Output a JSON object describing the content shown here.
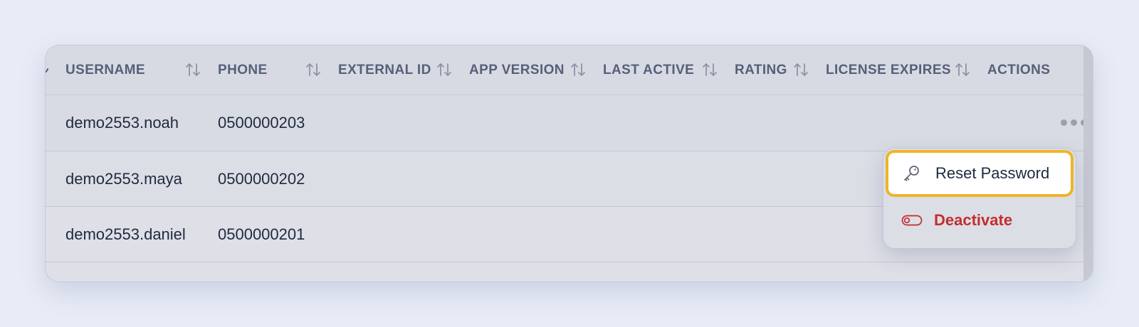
{
  "table": {
    "columns": [
      {
        "label": "USERNAME",
        "sortable": true
      },
      {
        "label": "PHONE",
        "sortable": true
      },
      {
        "label": "EXTERNAL ID",
        "sortable": true
      },
      {
        "label": "APP VERSION",
        "sortable": true
      },
      {
        "label": "LAST ACTIVE",
        "sortable": true
      },
      {
        "label": "RATING",
        "sortable": true
      },
      {
        "label": "LICENSE EXPIRES",
        "sortable": true
      },
      {
        "label": "ACTIONS",
        "sortable": false
      }
    ],
    "rows": [
      {
        "username": "demo2553.noah",
        "phone": "0500000203",
        "external_id": "",
        "app_version": "",
        "last_active": "",
        "rating": "",
        "license_expires": ""
      },
      {
        "username": "demo2553.maya",
        "phone": "0500000202",
        "external_id": "",
        "app_version": "",
        "last_active": "",
        "rating": "",
        "license_expires": ""
      },
      {
        "username": "demo2553.daniel",
        "phone": "0500000201",
        "external_id": "",
        "app_version": "",
        "last_active": "",
        "rating": "",
        "license_expires": ""
      }
    ]
  },
  "actions_menu": {
    "items": [
      {
        "label": "Reset Password",
        "icon": "key-icon",
        "highlighted": true
      },
      {
        "label": "Deactivate",
        "icon": "toggle-off-icon",
        "danger": true
      }
    ]
  },
  "icons": {
    "sort": "sort-arrows-icon",
    "more": "more-horizontal-icon"
  },
  "colors": {
    "focus_ring": "#f0b429",
    "danger": "#c42d2d",
    "header_text": "#55607a",
    "page_bg": "#e8ecf6"
  }
}
